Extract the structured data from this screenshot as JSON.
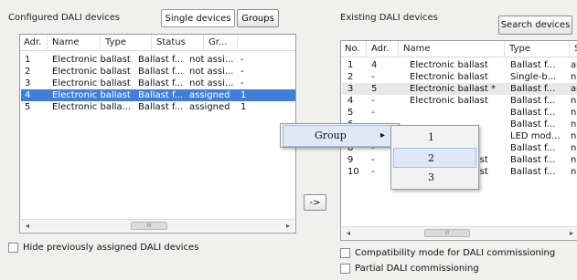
{
  "left_panel": {
    "title": "Configured DALI devices",
    "tabs": [
      {
        "label": "Single devices",
        "active": true
      },
      {
        "label": "Groups",
        "active": false
      }
    ],
    "columns": [
      "Adr.",
      "Name",
      "Type",
      "Status",
      "Gr..."
    ],
    "rows": [
      {
        "adr": "1",
        "name": "Electronic ballast",
        "type": "Ballast f...",
        "status": "not assi...",
        "group": "-",
        "selected": false
      },
      {
        "adr": "2",
        "name": "Electronic ballast",
        "type": "Ballast f...",
        "status": "not assi...",
        "group": "-",
        "selected": false
      },
      {
        "adr": "3",
        "name": "Electronic ballast",
        "type": "Ballast f...",
        "status": "not assi...",
        "group": "-",
        "selected": false
      },
      {
        "adr": "4",
        "name": "Electronic ballast",
        "type": "Ballast f...",
        "status": "assigned",
        "group": "1",
        "selected": true
      },
      {
        "adr": "5",
        "name": "Electronic balla...",
        "type": "Ballast f...",
        "status": "assigned",
        "group": "1",
        "selected": false
      }
    ],
    "hide_checkbox_label": "Hide previously assigned DALI devices"
  },
  "transfer_button": {
    "label": "->"
  },
  "right_panel": {
    "title": "Existing DALI devices",
    "search_button_label": "Search devices",
    "columns": [
      "No.",
      "Adr.",
      "Name",
      "Type",
      "St"
    ],
    "rows": [
      {
        "no": "1",
        "adr": "4",
        "name": "Electronic ballast",
        "type": "Ballast f...",
        "st": "as"
      },
      {
        "no": "2",
        "adr": "-",
        "name": "Electronic ballast",
        "type": "Single-b...",
        "st": "nc"
      },
      {
        "no": "3",
        "adr": "5",
        "name": "Electronic ballast *",
        "type": "Ballast f...",
        "st": "as"
      },
      {
        "no": "4",
        "adr": "-",
        "name": "Electronic ballast",
        "type": "Ballast f...",
        "st": "nc"
      },
      {
        "no": "5",
        "adr": "-",
        "name": "",
        "type": "Ballast f...",
        "st": "nc"
      },
      {
        "no": "6",
        "adr": "-",
        "name": "",
        "type": "Ballast f...",
        "st": "nc"
      },
      {
        "no": "7",
        "adr": "-",
        "name": "",
        "type": "LED mod...",
        "st": "nc"
      },
      {
        "no": "8",
        "adr": "-",
        "name": "",
        "type": "Ballast f...",
        "st": "nc"
      },
      {
        "no": "9",
        "adr": "-",
        "name": "Electronic ballast",
        "type": "Ballast f...",
        "st": "nc"
      },
      {
        "no": "10",
        "adr": "-",
        "name": "Electronic ballast",
        "type": "Ballast f...",
        "st": "nc"
      }
    ],
    "compat_checkbox_label": "Compatibility mode for DALI commissioning",
    "partial_checkbox_label": "Partial DALI commissioning"
  },
  "context_menu": {
    "item_label": "Group",
    "submenu_arrow": "▸",
    "submenu_items": [
      "1",
      "2",
      "3"
    ],
    "highlighted_item": "2"
  },
  "icons": {
    "scroll_left": "◂",
    "scroll_right": "▸",
    "scroll_grip": "III"
  }
}
